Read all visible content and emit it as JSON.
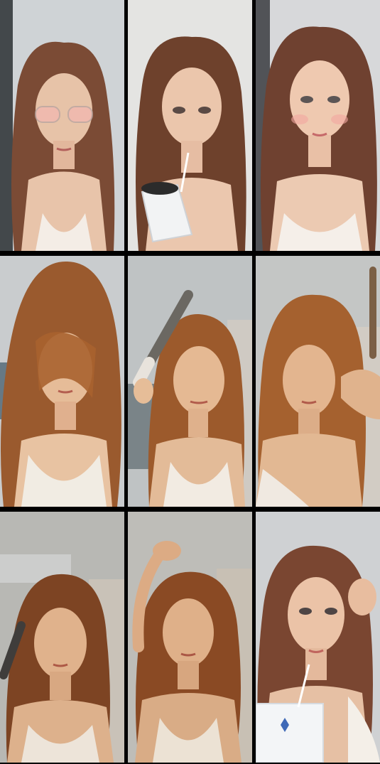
{
  "collage": {
    "rows": 3,
    "columns": 3,
    "frames": [
      {
        "row": 1,
        "col": 1,
        "scene": "tinted-glasses",
        "bg": "#cfd3d6",
        "hair": "#7b4b35"
      },
      {
        "row": 1,
        "col": 2,
        "scene": "drinking-straw",
        "bg": "#e4e4e2",
        "hair": "#6e412c"
      },
      {
        "row": 1,
        "col": 3,
        "scene": "front-face",
        "bg": "#d7d8da",
        "hair": "#6f4130"
      },
      {
        "row": 2,
        "col": 1,
        "scene": "hair-forward",
        "bg": "#c9ccce",
        "hair": "#9a5a2e"
      },
      {
        "row": 2,
        "col": 2,
        "scene": "curling-iron",
        "bg": "#bfc3c4",
        "hair": "#9c5a2c"
      },
      {
        "row": 2,
        "col": 3,
        "scene": "curling-iron-right",
        "bg": "#c4c6c5",
        "hair": "#a5612f"
      },
      {
        "row": 3,
        "col": 1,
        "scene": "curling-left",
        "bg": "#b8b8b4",
        "hair": "#7d4423"
      },
      {
        "row": 3,
        "col": 2,
        "scene": "arm-raised",
        "bg": "#bebdb8",
        "hair": "#8a4a24"
      },
      {
        "row": 3,
        "col": 3,
        "scene": "cup-and-straw",
        "bg": "#cfd1d3",
        "hair": "#7a4631"
      }
    ]
  }
}
